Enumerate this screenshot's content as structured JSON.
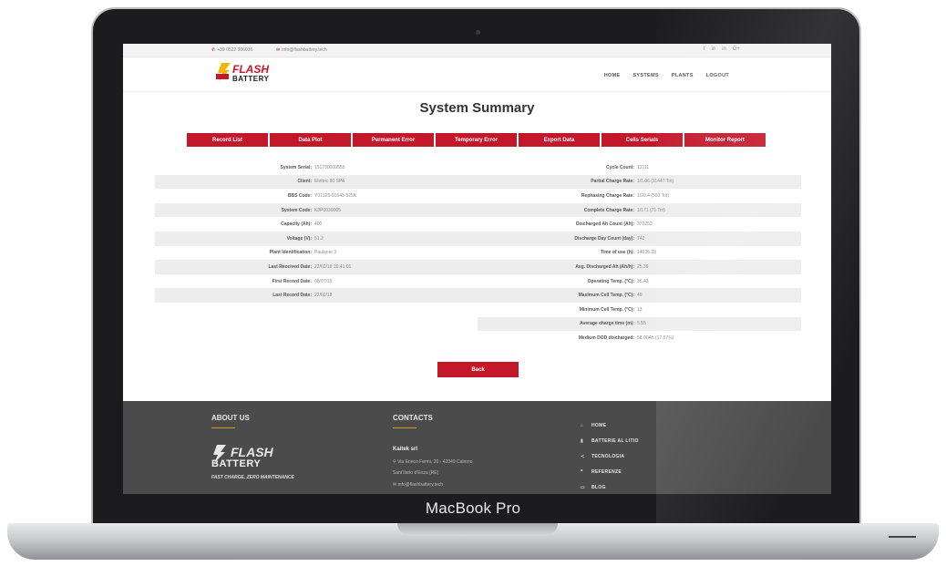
{
  "device_label": "MacBook Pro",
  "topbar": {
    "phone": "+39 0522 906035",
    "email": "info@flashbattery.tech",
    "social": [
      "f",
      "in",
      "in",
      "G+"
    ]
  },
  "logo": {
    "word1": "FLASH",
    "word2": "BATTERY",
    "mark": "®"
  },
  "nav": [
    "HOME",
    "SYSTEMS",
    "PLANTS",
    "LOGOUT"
  ],
  "page_title": "System Summary",
  "tabs": [
    "Record List",
    "Data Plot",
    "Permanent Error",
    "Temporary Error",
    "Export Data",
    "Cells Serials",
    "Monitor Report"
  ],
  "left_fields": [
    {
      "k": "System Serial:",
      "v": "151730000555"
    },
    {
      "k": "Client:",
      "v": "Elettric 80 SPA"
    },
    {
      "k": "BBS Code:",
      "v": "Y01325-01643-525K"
    },
    {
      "k": "System Code:",
      "v": "K8P0030005"
    },
    {
      "k": "Capacity (Ah):",
      "v": "400"
    },
    {
      "k": "Voltage (V):",
      "v": "51.2"
    },
    {
      "k": "Plant Identification:",
      "v": "Paulaner 3"
    },
    {
      "k": "Last Received Date:",
      "v": "22/02/18 16:41:01"
    },
    {
      "k": "First Record Date:",
      "v": "08/07/15"
    },
    {
      "k": "Last Record Date:",
      "v": "22/02/18"
    }
  ],
  "right_fields": [
    {
      "k": "Cycle Count:",
      "v": "12111"
    },
    {
      "k": "Partial Charge Rate:",
      "v": "1/1.06 (11447 Tot)"
    },
    {
      "k": "Rephasing Charge Rate:",
      "v": "1/20.4 (593 Tot)"
    },
    {
      "k": "Complete Charge Rate:",
      "v": "1/171 (71 Tot)"
    },
    {
      "k": "Discharged Ah Count (Ah):",
      "v": "372253"
    },
    {
      "k": "Discharge Day Count (day):",
      "v": "742"
    },
    {
      "k": "Time of use (h):",
      "v": "14035.33"
    },
    {
      "k": "Avg. Discharged Ah (Ah/h):",
      "v": "25.36"
    },
    {
      "k": "Operating Temp. (°C):",
      "v": "35.43"
    },
    {
      "k": "Maximum Cell Temp. (°C):",
      "v": "49"
    },
    {
      "k": "Minimum Cell Temp. (°C):",
      "v": "13"
    },
    {
      "k": "Average charge time (m):",
      "v": "5.55"
    },
    {
      "k": "Medium DOD discharged:",
      "v": "58.00Ah (17.87%)"
    }
  ],
  "back_label": "Back",
  "footer": {
    "about_title": "ABOUT US",
    "contacts_title": "CONTACTS",
    "tagline": "FAST CHARGE, ZERO MAINTENANCE",
    "company": "Kaitek srl",
    "address": "Via Enrico Fermi, 20 - 42049 Calerno",
    "city": "Sant'Ilario d'Enza (RE)",
    "email": "info@flashbattery.tech",
    "links": [
      {
        "icon": "home-icon",
        "glyph": "⌂",
        "label": "HOME"
      },
      {
        "icon": "battery-icon",
        "glyph": "▮",
        "label": "BATTERIE AL LITIO"
      },
      {
        "icon": "share-icon",
        "glyph": "≺",
        "label": "TECNOLOGIA"
      },
      {
        "icon": "quote-icon",
        "glyph": "❞",
        "label": "REFERENZE"
      },
      {
        "icon": "monitor-icon",
        "glyph": "▭",
        "label": "BLOG"
      }
    ]
  },
  "colors": {
    "accent": "#c3182a",
    "footer_bg": "#4b4b4b",
    "divider": "#d4a017"
  }
}
